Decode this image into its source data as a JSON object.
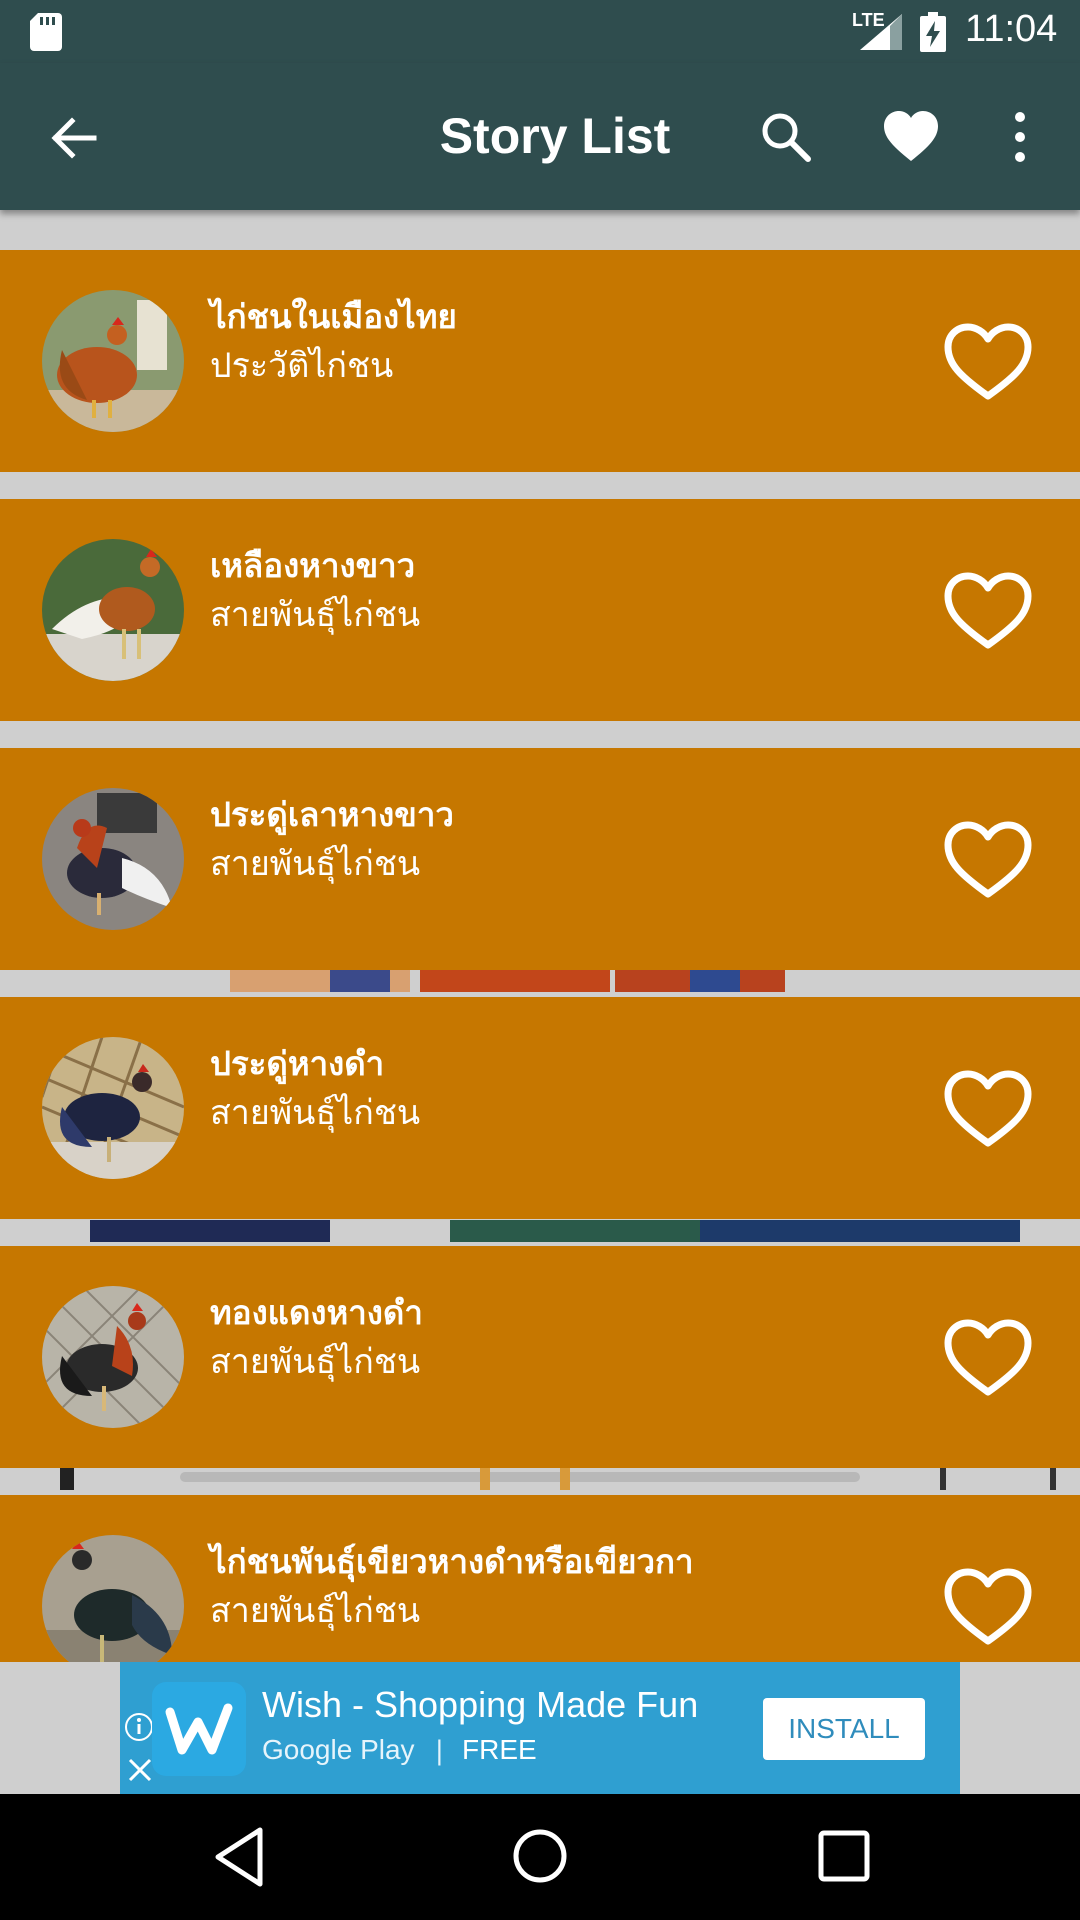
{
  "status_bar": {
    "time": "11:04",
    "network": "LTE"
  },
  "toolbar": {
    "title": "Story List"
  },
  "stories": [
    {
      "name": "ไก่ชนในเมืองไทย",
      "category": "ประวัติไก่ชน"
    },
    {
      "name": "เหลืองหางขาว",
      "category": "สายพันธุ์ไก่ชน"
    },
    {
      "name": "ประดู่เลาหางขาว",
      "category": "สายพันธุ์ไก่ชน"
    },
    {
      "name": "ประดู่หางดำ",
      "category": "สายพันธุ์ไก่ชน"
    },
    {
      "name": "ทองแดงหางดำ",
      "category": "สายพันธุ์ไก่ชน"
    },
    {
      "name": "ไก่ชนพันธุ์เขียวหางดำหรือเขียวกา",
      "category": "สายพันธุ์ไก่ชน"
    }
  ],
  "ad": {
    "headline": "Wish - Shopping Made Fun",
    "store": "Google Play",
    "price": "FREE",
    "install_label": "INSTALL"
  },
  "colors": {
    "primary": "#2f4d4e",
    "item_background": "#c67700",
    "ad_background": "#2f9fd1"
  }
}
